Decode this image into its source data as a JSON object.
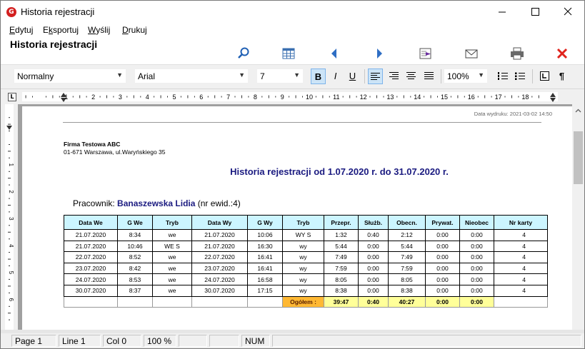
{
  "window": {
    "title": "Historia rejestracji",
    "app_icon": "G"
  },
  "menu": [
    {
      "label": "Edytuj",
      "key": "E",
      "rest": "dytuj"
    },
    {
      "label": "Eksportuj",
      "key": "k",
      "pre": "E",
      "rest": "sportuj"
    },
    {
      "label": "Wyślij",
      "key": "W",
      "rest": "yślij"
    },
    {
      "label": "Drukuj",
      "key": "D",
      "rest": "rukuj"
    }
  ],
  "toolbar": {
    "form_title": "Historia rejestracji",
    "icons": [
      "search-icon",
      "table-icon",
      "prev-icon",
      "next-icon",
      "export-icon",
      "mail-icon",
      "print-icon",
      "close-icon"
    ]
  },
  "format": {
    "style": "Normalny",
    "font": "Arial",
    "size": "7",
    "bold": "B",
    "italic": "I",
    "underline": "U",
    "zoom": "100%",
    "pilcrow": "¶"
  },
  "ruler": {
    "numbers": [
      "1",
      "2",
      "3",
      "4",
      "5",
      "6",
      "7",
      "8",
      "9",
      "10",
      "11",
      "12",
      "13",
      "14",
      "15",
      "16",
      "17",
      "18"
    ]
  },
  "vruler": {
    "numbers": [
      "1",
      "2",
      "3",
      "4",
      "5",
      "6"
    ]
  },
  "report": {
    "print_date": "Data wydruku: 2021-03-02  14:50",
    "company_name": "Firma Testowa ABC",
    "company_address": "01-671 Warszawa, ul.Waryńskiego 35",
    "title": "Historia rejestracji od 1.07.2020 r.  do 31.07.2020 r.",
    "employee_label": "Pracownik:",
    "employee_name": "Banaszewska Lidia",
    "employee_id": "(nr ewid.:4)",
    "columns": [
      "Data We",
      "G We",
      "Tryb",
      "Data Wy",
      "G Wy",
      "Tryb",
      "Przepr.",
      "Służb.",
      "Obecn.",
      "Prywat.",
      "Nieobec",
      "Nr karty"
    ],
    "rows": [
      [
        "21.07.2020",
        "8:34",
        "we",
        "21.07.2020",
        "10:06",
        "WY S",
        "1:32",
        "0:40",
        "2:12",
        "0:00",
        "0:00",
        "4"
      ],
      [
        "21.07.2020",
        "10:46",
        "WE S",
        "21.07.2020",
        "16:30",
        "wy",
        "5:44",
        "0:00",
        "5:44",
        "0:00",
        "0:00",
        "4"
      ],
      [
        "22.07.2020",
        "8:52",
        "we",
        "22.07.2020",
        "16:41",
        "wy",
        "7:49",
        "0:00",
        "7:49",
        "0:00",
        "0:00",
        "4"
      ],
      [
        "23.07.2020",
        "8:42",
        "we",
        "23.07.2020",
        "16:41",
        "wy",
        "7:59",
        "0:00",
        "7:59",
        "0:00",
        "0:00",
        "4"
      ],
      [
        "24.07.2020",
        "8:53",
        "we",
        "24.07.2020",
        "16:58",
        "wy",
        "8:05",
        "0:00",
        "8:05",
        "0:00",
        "0:00",
        "4"
      ],
      [
        "30.07.2020",
        "8:37",
        "we",
        "30.07.2020",
        "17:15",
        "wy",
        "8:38",
        "0:00",
        "8:38",
        "0:00",
        "0:00",
        "4"
      ]
    ],
    "total_label": "Ogółem :",
    "totals": [
      "39:47",
      "0:40",
      "40:27",
      "0:00",
      "0:00"
    ]
  },
  "status": {
    "page": "Page  1",
    "line": "Line  1",
    "col": "Col  0",
    "zoom": "100 %",
    "num": "NUM"
  }
}
